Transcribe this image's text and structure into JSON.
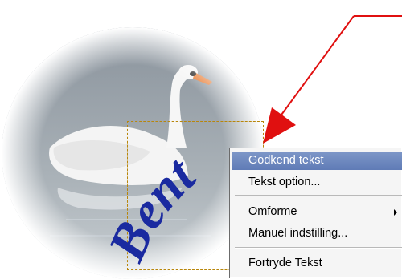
{
  "image": {
    "subject": "swan-photo",
    "curved_text": "Bent"
  },
  "context_menu": {
    "items": [
      {
        "label": "Godkend tekst",
        "state": "highlighted"
      },
      {
        "label": "Tekst option..."
      },
      {
        "label": "Omforme",
        "has_submenu": true
      },
      {
        "label": "Manuel indstilling..."
      },
      {
        "label": "Fortryde Tekst"
      }
    ]
  },
  "colors": {
    "arrow": "#e01010",
    "text": "#1a2aa0",
    "menu_highlight": "#6e89c0",
    "selection_border": "#b8860b"
  }
}
